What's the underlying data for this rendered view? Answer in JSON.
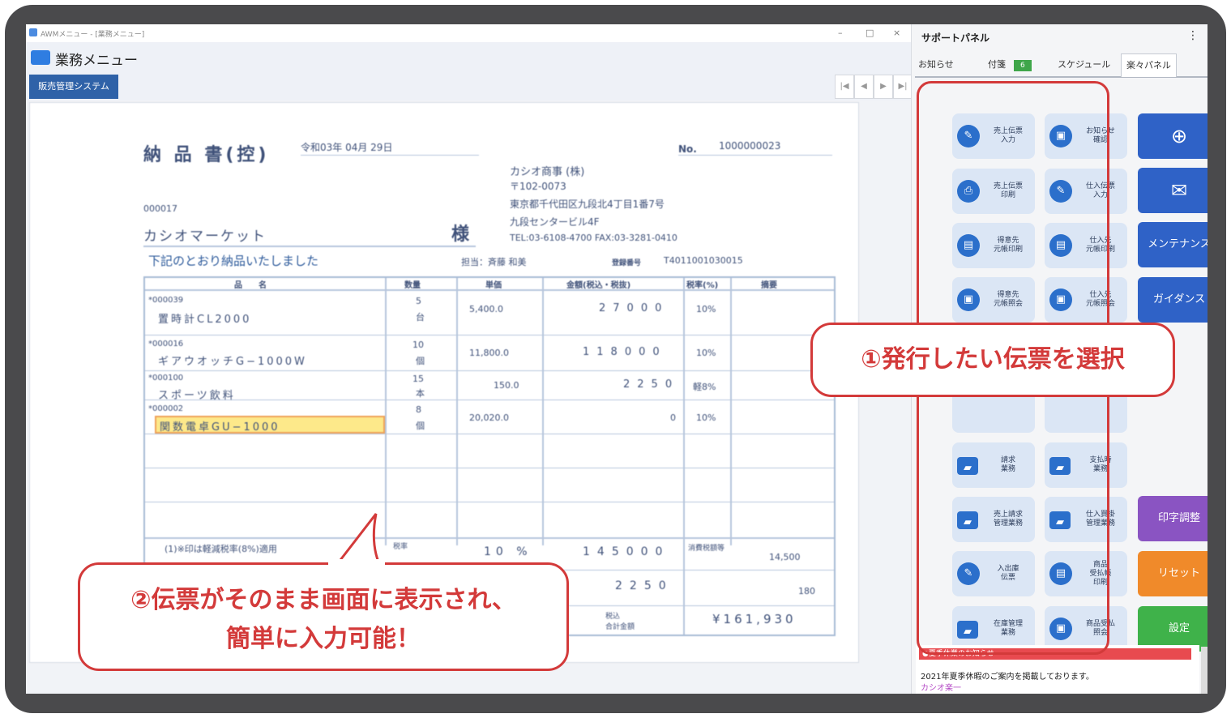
{
  "window": {
    "title": "AWMメニュー - [業務メニュー]",
    "controls": {
      "minimize": "–",
      "maximize": "□",
      "close": "×"
    },
    "menu_title": "業務メニュー",
    "tab": "販売管理システム",
    "nav": [
      "|◀",
      "◀",
      "▶",
      "▶|"
    ]
  },
  "document": {
    "title": "納 品 書(控)",
    "date": "令和03年 04月 29日",
    "no_label": "No.",
    "no_value": "1000000023",
    "company": "カシオ商事 (株)",
    "postal": "〒102-0073",
    "address1": "東京都千代田区九段北4丁目1番7号",
    "address2": "九段センタービル4F",
    "tel_fax": "TEL:03-6108-4700   FAX:03-3281-0410",
    "customer_code": "000017",
    "customer_name": "カシオマーケット",
    "honorific": "様",
    "message": "下記のとおり納品いたしました",
    "staff": "担当：斉藤 和美",
    "reg_label": "登録番号",
    "reg_number": "T4011001030015",
    "headers": [
      "品　　名",
      "数量",
      "単価",
      "金額(税込・税抜)",
      "税率(%)",
      "摘要"
    ],
    "rows": [
      {
        "code": "*000039",
        "name": "置時計CL2000",
        "qty": "5",
        "unit": "台",
        "price": "5,400.0",
        "amount": "27000",
        "tax": "10%"
      },
      {
        "code": "*000016",
        "name": "ギアウオッチG−1000W",
        "qty": "10",
        "unit": "個",
        "price": "11,800.0",
        "amount": "118000",
        "tax": "10%"
      },
      {
        "code": "*000100",
        "name": "スポーツ飲料",
        "qty": "15",
        "unit": "本",
        "price": "150.0",
        "amount": "2250",
        "tax": "軽8%"
      },
      {
        "code": "*000002",
        "name": "関数電卓GU−1000",
        "qty": "8",
        "unit": "個",
        "price": "20,020.0",
        "amount": "0",
        "tax": "10%"
      }
    ],
    "footer_tax_label": "税率",
    "footer_tax_rate": "10 %",
    "footer_amount1": "145000",
    "footer_amount2": "2250",
    "footer_label1": "消費税額等",
    "footer_value1": "14,500",
    "footer_value2": "180",
    "total_label": "税込\n合計金額",
    "total": "¥161,930",
    "note": "(1)※印は軽減税率(8%)適用"
  },
  "panel": {
    "title": "サポートパネル",
    "menu_icon": "⋮",
    "tabs": [
      "お知らせ",
      "付箋",
      "スケジュール",
      "楽々パネル"
    ],
    "badge": "6",
    "buttons": [
      {
        "label": "売上伝票\n入力",
        "icon": "document-hand-icon"
      },
      {
        "label": "お知らせ\n確認",
        "icon": "monitor-icon"
      },
      {
        "label": "売上伝票\n印刷",
        "icon": "print-icon"
      },
      {
        "label": "仕入伝票\n入力",
        "icon": "document-hand-icon"
      },
      {
        "label": "得意先\n元帳印刷",
        "icon": "ledger-icon"
      },
      {
        "label": "仕入先\n元帳印刷",
        "icon": "ledger-icon"
      },
      {
        "label": "得意先\n元帳照会",
        "icon": "monitor-icon"
      },
      {
        "label": "仕入先\n元帳照会",
        "icon": "monitor-icon"
      },
      {
        "label": "請求\n業務",
        "icon": "folder-icon"
      },
      {
        "label": "支払時\n業務",
        "icon": "folder-icon"
      },
      {
        "label": "売上請求\n管理業務",
        "icon": "folder-icon"
      },
      {
        "label": "仕入買掛\n管理業務",
        "icon": "folder-icon"
      },
      {
        "label": "入出庫\n伝票",
        "icon": "document-hand-icon"
      },
      {
        "label": "商品\n受払帳\n印刷",
        "icon": "ledger-icon"
      },
      {
        "label": "在庫管理\n業務",
        "icon": "folder-icon"
      },
      {
        "label": "商品受払\n照会",
        "icon": "monitor-icon"
      }
    ],
    "side_buttons": [
      {
        "label": "",
        "icon": "globe-icon",
        "color": "#2f62c7"
      },
      {
        "label": "",
        "icon": "mail-icon",
        "color": "#2f62c7"
      },
      {
        "label": "メンテナンス",
        "color": "#2f62c7"
      },
      {
        "label": "ガイダンス",
        "color": "#2f62c7"
      },
      {
        "label": "印字調整",
        "color": "#8a54c2"
      },
      {
        "label": "リセット",
        "color": "#f08a2a"
      },
      {
        "label": "設定",
        "color": "#3fb24a"
      }
    ],
    "notice_head": "●夏季休業のお知らせ",
    "notice_body": "2021年夏季休暇のご案内を掲載しております。",
    "notice_sub": "カシオ楽一"
  },
  "callouts": {
    "one": "①発行したい伝票を選択",
    "two_line1": "②伝票がそのまま画面に表示され、",
    "two_line2": "簡単に入力可能！"
  },
  "colors": {
    "accent_red": "#d33a3a",
    "blue": "#2f62c7"
  }
}
